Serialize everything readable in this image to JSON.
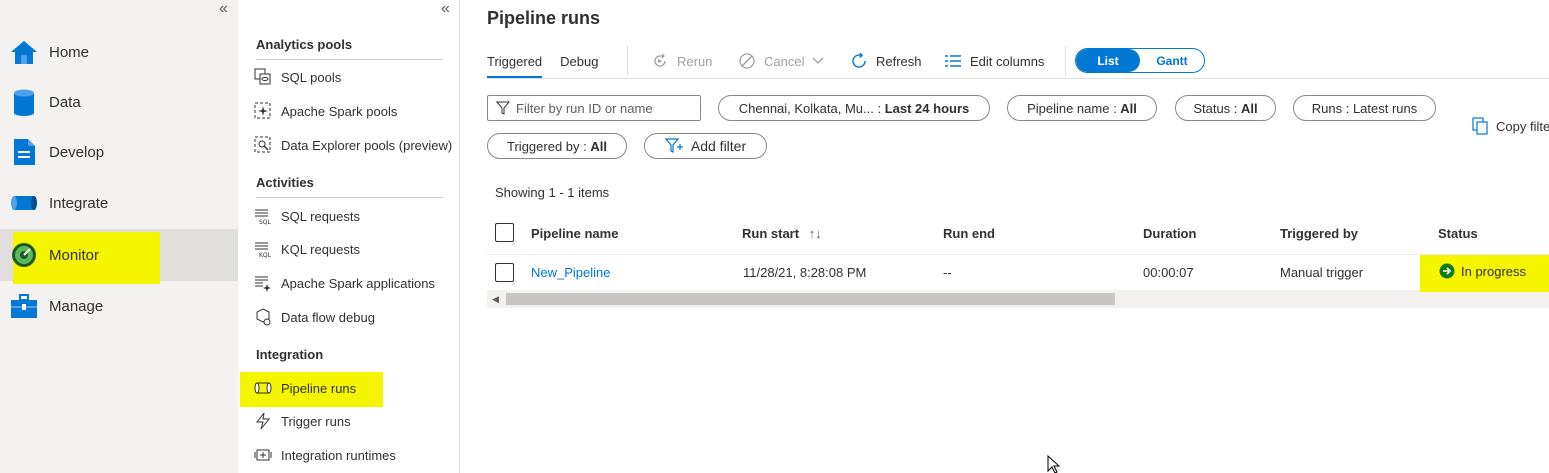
{
  "leftnav": {
    "collapse_glyph": "«",
    "items": [
      {
        "label": "Home",
        "icon": "home-icon"
      },
      {
        "label": "Data",
        "icon": "database-icon"
      },
      {
        "label": "Develop",
        "icon": "document-icon"
      },
      {
        "label": "Integrate",
        "icon": "pipeline-icon"
      },
      {
        "label": "Monitor",
        "icon": "gauge-icon"
      },
      {
        "label": "Manage",
        "icon": "toolbox-icon"
      }
    ],
    "selected": "Monitor"
  },
  "subnav": {
    "collapse_glyph": "«",
    "sections": [
      {
        "title": "Analytics pools",
        "items": [
          "SQL pools",
          "Apache Spark pools",
          "Data Explorer pools (preview)"
        ]
      },
      {
        "title": "Activities",
        "items": [
          "SQL requests",
          "KQL requests",
          "Apache Spark applications",
          "Data flow debug"
        ]
      },
      {
        "title": "Integration",
        "items": [
          "Pipeline runs",
          "Trigger runs",
          "Integration runtimes"
        ]
      }
    ],
    "selected": "Pipeline runs"
  },
  "main": {
    "title": "Pipeline runs",
    "tabs": [
      "Triggered",
      "Debug"
    ],
    "active_tab": "Triggered",
    "toolbar": {
      "rerun": "Rerun",
      "cancel": "Cancel",
      "refresh": "Refresh",
      "edit_columns": "Edit columns"
    },
    "view_toggle": {
      "list": "List",
      "gantt": "Gantt",
      "selected": "List"
    },
    "filter": {
      "placeholder": "Filter by run ID or name"
    },
    "pills": {
      "timerange": {
        "key": "Chennai, Kolkata, Mu...",
        "sep": " : ",
        "value": "Last 24 hours"
      },
      "pipeline_name": {
        "key": "Pipeline name",
        "sep": " : ",
        "value": "All"
      },
      "status": {
        "key": "Status",
        "sep": " : ",
        "value": "All"
      },
      "runs": {
        "key": "Runs",
        "sep": " : ",
        "value": "Latest runs"
      },
      "triggered_by": {
        "key": "Triggered by",
        "sep": " : ",
        "value": "All"
      },
      "add_filter": "Add filter"
    },
    "copy_filter": "Copy filte",
    "showing": "Showing 1 - 1 items",
    "table": {
      "headers": {
        "pipeline_name": "Pipeline name",
        "run_start": "Run start",
        "run_end": "Run end",
        "duration": "Duration",
        "triggered_by": "Triggered by",
        "status": "Status"
      },
      "sort_glyph": "↑↓",
      "rows": [
        {
          "pipeline_name": "New_Pipeline",
          "run_start": "11/28/21, 8:28:08 PM",
          "run_end": "--",
          "duration": "00:00:07",
          "triggered_by": "Manual trigger",
          "status": "In progress"
        }
      ]
    },
    "colors": {
      "accent": "#0078d4",
      "highlight": "#f5f500",
      "status_in_progress": "#107c10"
    }
  }
}
